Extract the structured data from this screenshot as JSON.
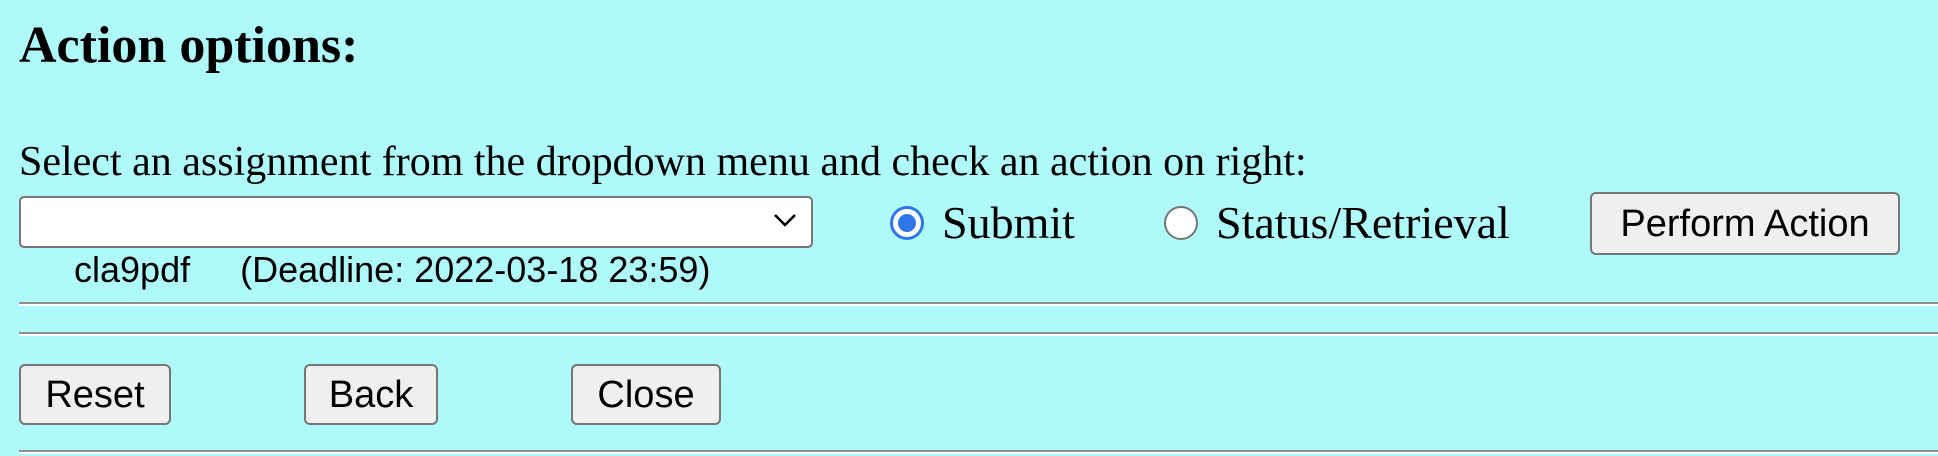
{
  "heading": "Action options:",
  "instruction": "Select an assignment from the dropdown menu and check an action on right:",
  "assignment_select": {
    "selected": "cla9pdf     (Deadline: 2022-03-18 23:59)"
  },
  "actions": {
    "submit_label": "Submit",
    "status_label": "Status/Retrieval",
    "selected": "Submit"
  },
  "buttons": {
    "perform": "Perform Action",
    "reset": "Reset",
    "back": "Back",
    "close": "Close"
  },
  "colors": {
    "background": "#aff9fb",
    "radio_accent": "#2f76e8",
    "button_bg": "#efefef"
  },
  "icons": {
    "dropdown": "chevron-down-icon"
  }
}
